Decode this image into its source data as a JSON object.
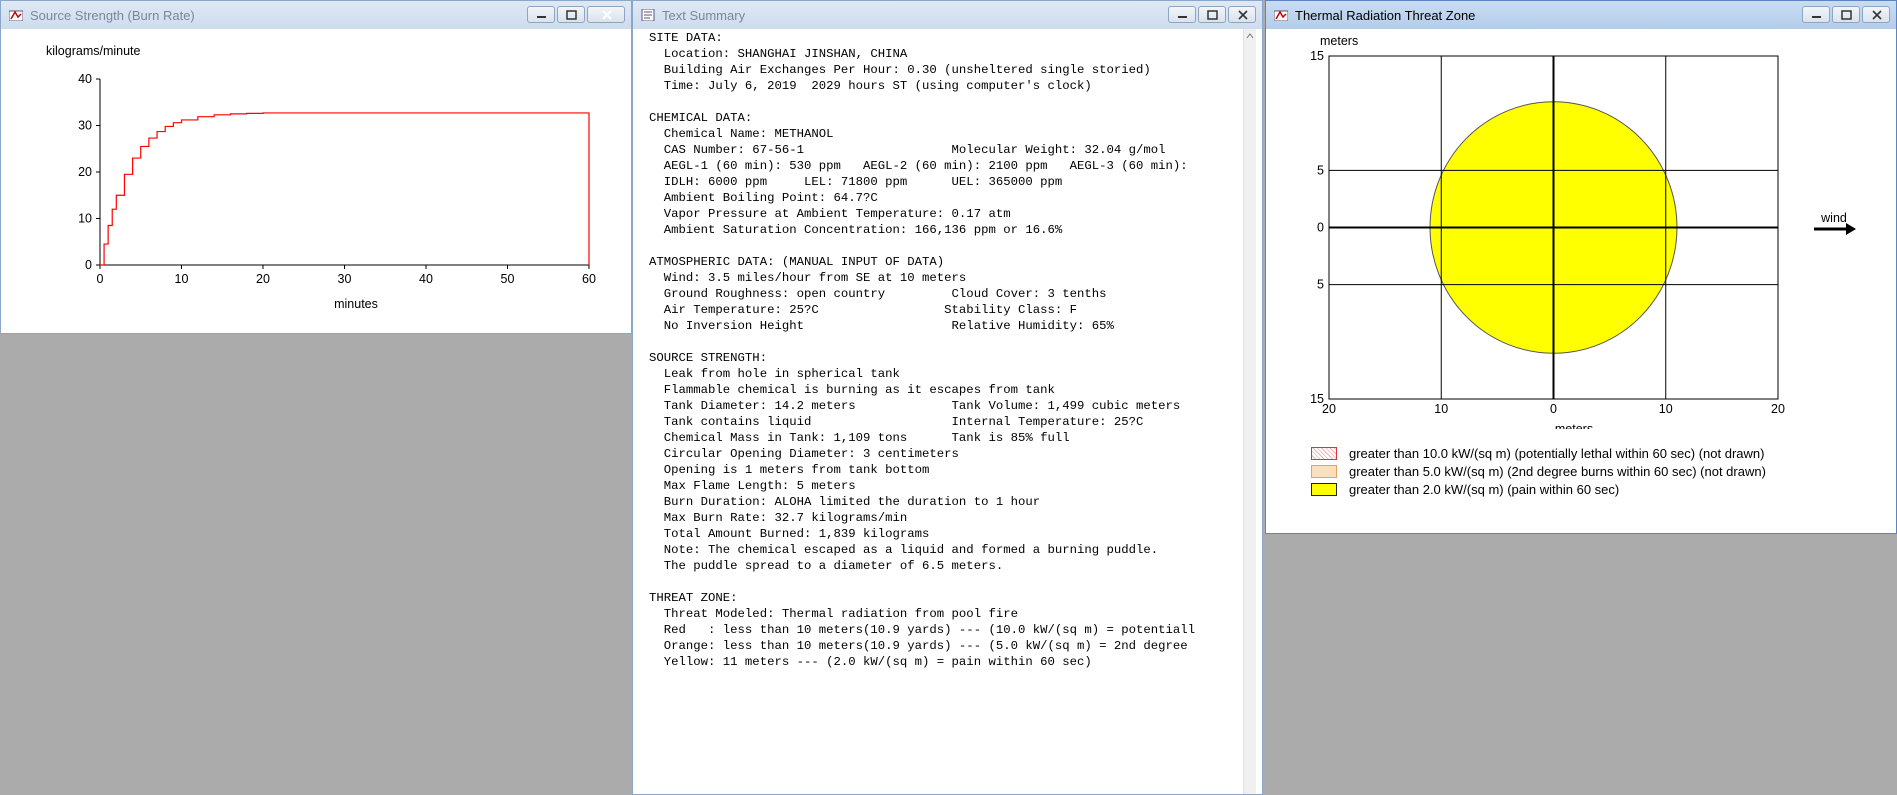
{
  "windows": {
    "source": {
      "title": "Source Strength (Burn Rate)"
    },
    "summary": {
      "title": "Text Summary"
    },
    "threat": {
      "title": "Thermal Radiation Threat Zone"
    }
  },
  "summary_lines": [
    "SITE DATA:",
    "  Location: SHANGHAI JINSHAN, CHINA",
    "  Building Air Exchanges Per Hour: 0.30 (unsheltered single storied)",
    "  Time: July 6, 2019  2029 hours ST (using computer's clock)",
    "",
    "CHEMICAL DATA:",
    "  Chemical Name: METHANOL",
    "  CAS Number: 67-56-1                    Molecular Weight: 32.04 g/mol",
    "  AEGL-1 (60 min): 530 ppm   AEGL-2 (60 min): 2100 ppm   AEGL-3 (60 min):",
    "  IDLH: 6000 ppm     LEL: 71800 ppm      UEL: 365000 ppm",
    "  Ambient Boiling Point: 64.7?C",
    "  Vapor Pressure at Ambient Temperature: 0.17 atm",
    "  Ambient Saturation Concentration: 166,136 ppm or 16.6%",
    "",
    "ATMOSPHERIC DATA: (MANUAL INPUT OF DATA)",
    "  Wind: 3.5 miles/hour from SE at 10 meters",
    "  Ground Roughness: open country         Cloud Cover: 3 tenths",
    "  Air Temperature: 25?C                 Stability Class: F",
    "  No Inversion Height                    Relative Humidity: 65%",
    "",
    "SOURCE STRENGTH:",
    "  Leak from hole in spherical tank",
    "  Flammable chemical is burning as it escapes from tank",
    "  Tank Diameter: 14.2 meters             Tank Volume: 1,499 cubic meters",
    "  Tank contains liquid                   Internal Temperature: 25?C",
    "  Chemical Mass in Tank: 1,109 tons      Tank is 85% full",
    "  Circular Opening Diameter: 3 centimeters",
    "  Opening is 1 meters from tank bottom",
    "  Max Flame Length: 5 meters",
    "  Burn Duration: ALOHA limited the duration to 1 hour",
    "  Max Burn Rate: 32.7 kilograms/min",
    "  Total Amount Burned: 1,839 kilograms",
    "  Note: The chemical escaped as a liquid and formed a burning puddle.",
    "  The puddle spread to a diameter of 6.5 meters.",
    "",
    "THREAT ZONE:",
    "  Threat Modeled: Thermal radiation from pool fire",
    "  Red   : less than 10 meters(10.9 yards) --- (10.0 kW/(sq m) = potentiall",
    "  Orange: less than 10 meters(10.9 yards) --- (5.0 kW/(sq m) = 2nd degree",
    "  Yellow: 11 meters --- (2.0 kW/(sq m) = pain within 60 sec)"
  ],
  "source_chart": {
    "ylabel": "kilograms/minute",
    "xlabel": "minutes",
    "yticks": [
      "0",
      "10",
      "20",
      "30",
      "40"
    ],
    "xticks": [
      "0",
      "10",
      "20",
      "30",
      "40",
      "50",
      "60"
    ]
  },
  "threat_chart": {
    "ylabel": "meters",
    "xlabel": "meters",
    "yticks": [
      "15",
      "5",
      "0",
      "5",
      "15"
    ],
    "xticks": [
      "20",
      "10",
      "0",
      "10",
      "20"
    ],
    "wind_label": "wind",
    "legend": [
      {
        "label": "greater than 10.0 kW/(sq m) (potentially lethal within 60 sec) (not drawn)",
        "color": "#ff0000"
      },
      {
        "label": "greater than 5.0 kW/(sq m) (2nd degree burns within 60 sec) (not drawn)",
        "color": "#ffa500"
      },
      {
        "label": "greater than 2.0 kW/(sq m) (pain within 60 sec)",
        "color": "#ffff00"
      }
    ]
  },
  "chart_data": [
    {
      "type": "line",
      "title": "",
      "xlabel": "minutes",
      "ylabel": "kilograms/minute",
      "xlim": [
        0,
        60
      ],
      "ylim": [
        0,
        40
      ],
      "series": [
        {
          "color": "#ff0000",
          "x": [
            0,
            0.5,
            1,
            1.5,
            2,
            3,
            4,
            5,
            6,
            7,
            8,
            9,
            10,
            12,
            14,
            16,
            18,
            20,
            25,
            30,
            40,
            50,
            60,
            60
          ],
          "y": [
            0,
            4.5,
            8.5,
            12,
            15,
            19.5,
            23,
            25.5,
            27.3,
            28.7,
            29.8,
            30.6,
            31.2,
            31.9,
            32.3,
            32.5,
            32.6,
            32.7,
            32.7,
            32.7,
            32.7,
            32.7,
            32.7,
            0
          ]
        }
      ]
    },
    {
      "type": "scatter",
      "title": "",
      "xlabel": "meters",
      "ylabel": "meters",
      "xlim": [
        -20,
        20
      ],
      "ylim": [
        -15,
        15
      ],
      "zones": [
        {
          "name": "yellow",
          "center": [
            0,
            0
          ],
          "radius_m": 11,
          "color": "#ffff00"
        }
      ]
    }
  ]
}
